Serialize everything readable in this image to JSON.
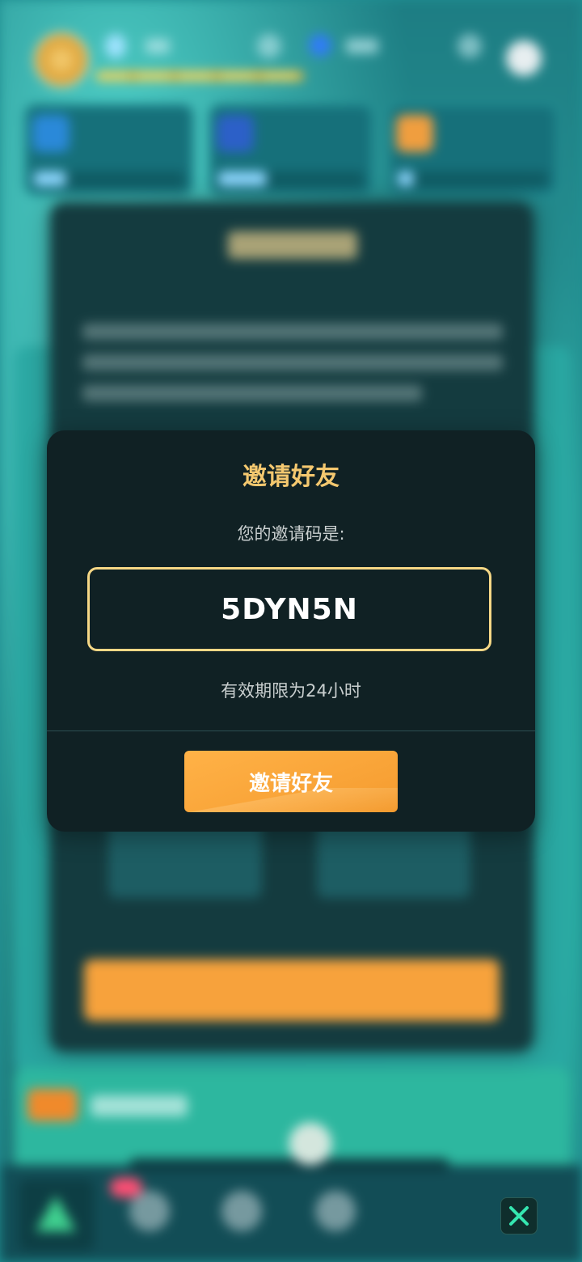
{
  "modal": {
    "title": "邀请好友",
    "subtitle": "您的邀请码是:",
    "invite_code": "5DYN5N",
    "validity_note": "有效期限为24小时",
    "button_label": "邀请好友"
  },
  "colors": {
    "title": "#f4c86f",
    "code_border": "#f6d886",
    "button": "#f8a236",
    "modal_bg": "#102124",
    "close_icon": "#35e6b0"
  },
  "icons": {
    "close": "close-icon"
  }
}
